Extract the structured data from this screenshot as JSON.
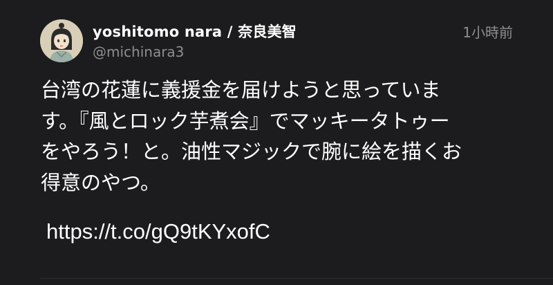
{
  "tweet": {
    "display_name": "yoshitomo nara / 奈良美智",
    "handle": "@michinara3",
    "timestamp": "1小時前",
    "avatar_icon": "avatar-portrait-icon",
    "body_lines": [
      "台湾の花蓮に義援金を届けようと思っていま",
      "す。『風とロック芋煮会』でマッキータトゥー",
      "をやろう！と。油性マジックで腕に絵を描くお",
      "得意のやつ。"
    ],
    "link": "https://t.co/gQ9tKYxofC"
  },
  "colors": {
    "background": "#1c1c1e",
    "text": "#ffffff",
    "secondary_text": "#8e8e93",
    "divider": "#2c2c2e"
  }
}
